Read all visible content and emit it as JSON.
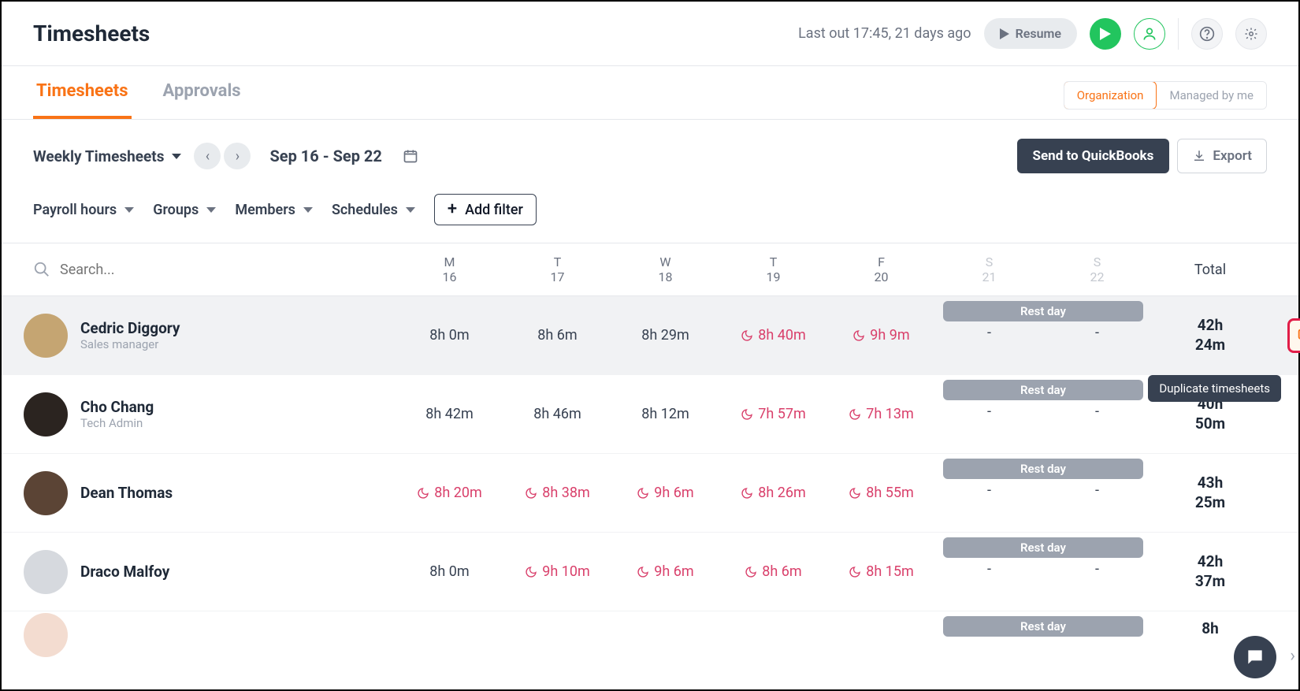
{
  "header": {
    "title": "Timesheets",
    "last_out": "Last out 17:45, 21 days ago",
    "resume": "Resume"
  },
  "tabs": {
    "timesheets": "Timesheets",
    "approvals": "Approvals"
  },
  "scope": {
    "organization": "Organization",
    "managed": "Managed by me"
  },
  "controls": {
    "view": "Weekly Timesheets",
    "date_range": "Sep 16 - Sep 22",
    "send_qb": "Send to QuickBooks",
    "export": "Export"
  },
  "filters": {
    "payroll": "Payroll hours",
    "groups": "Groups",
    "members": "Members",
    "schedules": "Schedules",
    "add_filter": "Add filter"
  },
  "search_placeholder": "Search...",
  "days": [
    {
      "dow": "M",
      "num": "16"
    },
    {
      "dow": "T",
      "num": "17"
    },
    {
      "dow": "W",
      "num": "18"
    },
    {
      "dow": "T",
      "num": "19"
    },
    {
      "dow": "F",
      "num": "20"
    },
    {
      "dow": "S",
      "num": "21"
    },
    {
      "dow": "S",
      "num": "22"
    }
  ],
  "total_label": "Total",
  "rest_day_label": "Rest day",
  "tooltip": "Duplicate timesheets",
  "rows": [
    {
      "name": "Cedric Diggory",
      "role": "Sales manager",
      "cells": [
        {
          "v": "8h 0m",
          "warn": false
        },
        {
          "v": "8h 6m",
          "warn": false
        },
        {
          "v": "8h 29m",
          "warn": false
        },
        {
          "v": "8h 40m",
          "warn": true
        },
        {
          "v": "9h 9m",
          "warn": true
        }
      ],
      "sat": "-",
      "sun": "-",
      "total_a": "42h",
      "total_b": "24m",
      "selected": true,
      "has_dup": true
    },
    {
      "name": "Cho Chang",
      "role": "Tech Admin",
      "cells": [
        {
          "v": "8h 42m",
          "warn": false
        },
        {
          "v": "8h 46m",
          "warn": false
        },
        {
          "v": "8h 12m",
          "warn": false
        },
        {
          "v": "7h 57m",
          "warn": true
        },
        {
          "v": "7h 13m",
          "warn": true
        }
      ],
      "sat": "-",
      "sun": "-",
      "total_a": "40h",
      "total_b": "50m",
      "selected": false,
      "has_dup": false
    },
    {
      "name": "Dean Thomas",
      "role": "",
      "cells": [
        {
          "v": "8h 20m",
          "warn": true
        },
        {
          "v": "8h 38m",
          "warn": true
        },
        {
          "v": "9h 6m",
          "warn": true
        },
        {
          "v": "8h 26m",
          "warn": true
        },
        {
          "v": "8h 55m",
          "warn": true
        }
      ],
      "sat": "-",
      "sun": "-",
      "total_a": "43h",
      "total_b": "25m",
      "selected": false,
      "has_dup": false
    },
    {
      "name": "Draco Malfoy",
      "role": "",
      "cells": [
        {
          "v": "8h 0m",
          "warn": false
        },
        {
          "v": "9h 10m",
          "warn": true
        },
        {
          "v": "9h 6m",
          "warn": true
        },
        {
          "v": "8h 6m",
          "warn": true
        },
        {
          "v": "8h 15m",
          "warn": true
        }
      ],
      "sat": "-",
      "sun": "-",
      "total_a": "42h",
      "total_b": "37m",
      "selected": false,
      "has_dup": false
    }
  ],
  "partial_row": {
    "rest": "Rest day",
    "total": "8h"
  },
  "avatar_colors": [
    "#c5a572",
    "#2b2420",
    "#5b4435",
    "#d6d9de",
    "#f3dcd0"
  ]
}
